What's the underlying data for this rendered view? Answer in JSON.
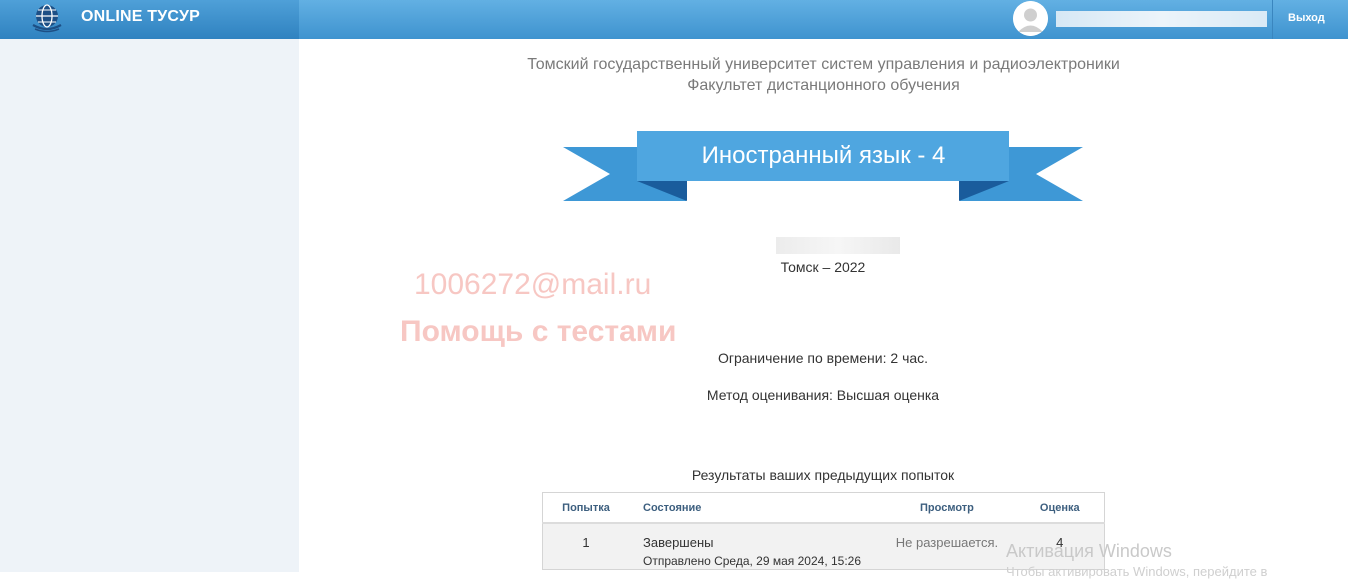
{
  "header": {
    "brand": "ONLINE ТУСУР",
    "logout": "Выход"
  },
  "main": {
    "university": "Томский государственный университет систем управления и радиоэлектроники",
    "faculty": "Факультет дистанционного обучения",
    "course_title": "Иностранный язык - 4",
    "city_year": "Томск – 2022",
    "time_limit": "Ограничение по времени: 2 час.",
    "grade_method": "Метод оценивания: Высшая оценка",
    "results_title": "Результаты ваших предыдущих попыток",
    "table": {
      "headers": [
        "Попытка",
        "Состояние",
        "Просмотр",
        "Оценка"
      ],
      "rows": [
        {
          "attempt": "1",
          "state": "Завершены",
          "submitted": "Отправлено Среда, 29 мая 2024, 15:26",
          "review": "Не разрешается.",
          "grade": "4"
        }
      ]
    }
  },
  "watermark": {
    "email": "1006272@mail.ru",
    "text": "Помощь с тестами"
  },
  "windows": {
    "activation_title": "Активация Windows",
    "activation_sub": "Чтобы активировать Windows, перейдите в"
  },
  "colors": {
    "header": "#4ea4dd",
    "ribbon": "#4fa6e0",
    "ribbon_dark": "#1a5c9c",
    "sidebar": "#eef3f8"
  }
}
